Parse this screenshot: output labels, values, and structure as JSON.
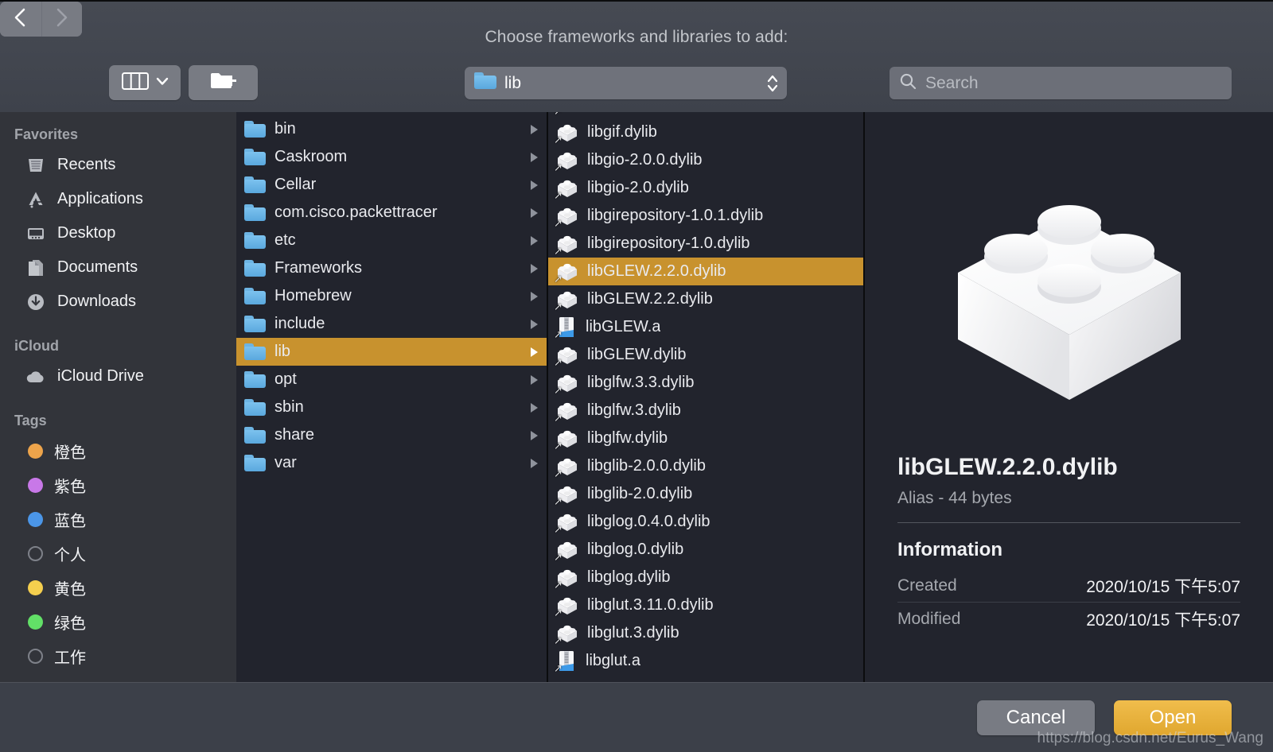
{
  "dialog": {
    "title": "Choose frameworks and libraries to add:"
  },
  "toolbar": {
    "back_icon": "chevron-left-icon",
    "forward_icon": "chevron-right-icon",
    "view_icon": "column-view-icon",
    "view_chevron_icon": "chevron-down-icon",
    "new_folder_icon": "new-folder-icon",
    "path_value": "lib",
    "path_folder_icon": "folder-icon",
    "stepper_icon": "up-down-stepper-icon",
    "search_icon": "search-icon",
    "search_placeholder": "Search",
    "search_value": ""
  },
  "sidebar": {
    "sections": [
      {
        "header": "Favorites",
        "items": [
          {
            "label": "Recents",
            "icon": "clock-recents-icon"
          },
          {
            "label": "Applications",
            "icon": "applications-icon"
          },
          {
            "label": "Desktop",
            "icon": "desktop-icon"
          },
          {
            "label": "Documents",
            "icon": "documents-icon"
          },
          {
            "label": "Downloads",
            "icon": "downloads-icon"
          }
        ]
      },
      {
        "header": "iCloud",
        "items": [
          {
            "label": "iCloud Drive",
            "icon": "cloud-icon"
          }
        ]
      },
      {
        "header": "Tags",
        "items": [
          {
            "label": "橙色",
            "icon": "tag-dot-icon",
            "color": "#eda44b"
          },
          {
            "label": "紫色",
            "icon": "tag-dot-icon",
            "color": "#c878e8"
          },
          {
            "label": "蓝色",
            "icon": "tag-dot-icon",
            "color": "#4b96e8"
          },
          {
            "label": "个人",
            "icon": "tag-dot-icon",
            "color": "none"
          },
          {
            "label": "黄色",
            "icon": "tag-dot-icon",
            "color": "#f5cf4e"
          },
          {
            "label": "绿色",
            "icon": "tag-dot-icon",
            "color": "#62e067"
          },
          {
            "label": "工作",
            "icon": "tag-dot-icon",
            "color": "none"
          }
        ]
      }
    ]
  },
  "columns": {
    "folders": [
      {
        "label": "bin",
        "icon": "folder-icon",
        "selected": false,
        "has_children": true
      },
      {
        "label": "Caskroom",
        "icon": "folder-icon",
        "selected": false,
        "has_children": true
      },
      {
        "label": "Cellar",
        "icon": "folder-icon",
        "selected": false,
        "has_children": true
      },
      {
        "label": "com.cisco.packettracer",
        "icon": "folder-icon",
        "selected": false,
        "has_children": true
      },
      {
        "label": "etc",
        "icon": "folder-icon",
        "selected": false,
        "has_children": true
      },
      {
        "label": "Frameworks",
        "icon": "folder-icon",
        "selected": false,
        "has_children": true
      },
      {
        "label": "Homebrew",
        "icon": "folder-icon",
        "selected": false,
        "has_children": true
      },
      {
        "label": "include",
        "icon": "folder-icon",
        "selected": false,
        "has_children": true
      },
      {
        "label": "lib",
        "icon": "folder-icon",
        "selected": true,
        "has_children": true
      },
      {
        "label": "opt",
        "icon": "folder-icon",
        "selected": false,
        "has_children": true
      },
      {
        "label": "sbin",
        "icon": "folder-icon",
        "selected": false,
        "has_children": true
      },
      {
        "label": "share",
        "icon": "folder-icon",
        "selected": false,
        "has_children": true
      },
      {
        "label": "var",
        "icon": "folder-icon",
        "selected": false,
        "has_children": true
      }
    ],
    "files": [
      {
        "label": "libgif.dylib",
        "icon": "dylib-brick-icon",
        "selected": false
      },
      {
        "label": "libgio-2.0.0.dylib",
        "icon": "dylib-brick-icon",
        "selected": false
      },
      {
        "label": "libgio-2.0.dylib",
        "icon": "dylib-brick-icon",
        "selected": false
      },
      {
        "label": "libgirepository-1.0.1.dylib",
        "icon": "dylib-brick-icon",
        "selected": false
      },
      {
        "label": "libgirepository-1.0.dylib",
        "icon": "dylib-brick-icon",
        "selected": false
      },
      {
        "label": "libGLEW.2.2.0.dylib",
        "icon": "dylib-brick-icon",
        "selected": true
      },
      {
        "label": "libGLEW.2.2.dylib",
        "icon": "dylib-brick-icon",
        "selected": false
      },
      {
        "label": "libGLEW.a",
        "icon": "archive-a-icon",
        "selected": false
      },
      {
        "label": "libGLEW.dylib",
        "icon": "dylib-brick-icon",
        "selected": false
      },
      {
        "label": "libglfw.3.3.dylib",
        "icon": "dylib-brick-icon",
        "selected": false
      },
      {
        "label": "libglfw.3.dylib",
        "icon": "dylib-brick-icon",
        "selected": false
      },
      {
        "label": "libglfw.dylib",
        "icon": "dylib-brick-icon",
        "selected": false
      },
      {
        "label": "libglib-2.0.0.dylib",
        "icon": "dylib-brick-icon",
        "selected": false
      },
      {
        "label": "libglib-2.0.dylib",
        "icon": "dylib-brick-icon",
        "selected": false
      },
      {
        "label": "libglog.0.4.0.dylib",
        "icon": "dylib-brick-icon",
        "selected": false
      },
      {
        "label": "libglog.0.dylib",
        "icon": "dylib-brick-icon",
        "selected": false
      },
      {
        "label": "libglog.dylib",
        "icon": "dylib-brick-icon",
        "selected": false
      },
      {
        "label": "libglut.3.11.0.dylib",
        "icon": "dylib-brick-icon",
        "selected": false
      },
      {
        "label": "libglut.3.dylib",
        "icon": "dylib-brick-icon",
        "selected": false
      },
      {
        "label": "libglut.a",
        "icon": "archive-a-icon",
        "selected": false
      }
    ]
  },
  "preview": {
    "icon": "dylib-brick-icon-large",
    "name": "libGLEW.2.2.0.dylib",
    "kind_size": "Alias - 44 bytes",
    "section_title": "Information",
    "info": [
      {
        "key": "Created",
        "value": "2020/10/15 下午5:07"
      },
      {
        "key": "Modified",
        "value": "2020/10/15 下午5:07"
      }
    ]
  },
  "footer": {
    "cancel_label": "Cancel",
    "open_label": "Open"
  },
  "watermark": "https://blog.csdn.net/Eurus_Wang",
  "colors": {
    "selection": "#c8922e",
    "accent_open_button": "#e0a72f",
    "sidebar_bg": "#32343a",
    "column_bg": "#22242d",
    "toolbar_bg": "#42464f"
  }
}
